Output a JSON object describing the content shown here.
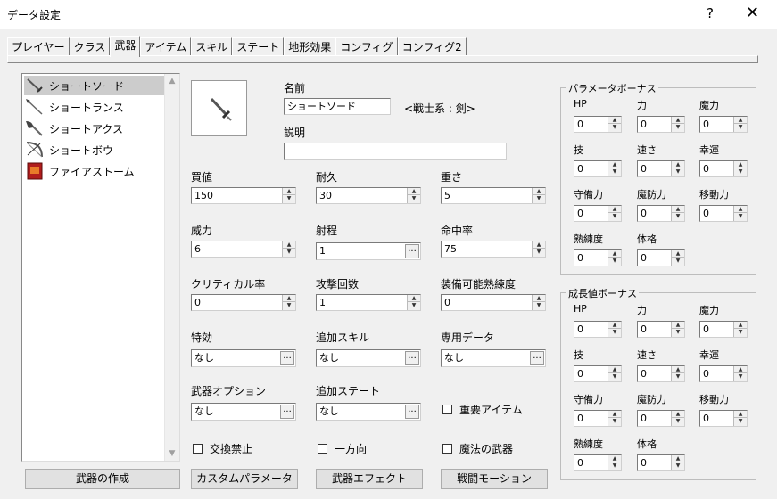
{
  "window": {
    "title": "データ設定",
    "help": "?",
    "close": "✕"
  },
  "tabs": [
    {
      "label": "プレイヤー"
    },
    {
      "label": "クラス"
    },
    {
      "label": "武器"
    },
    {
      "label": "アイテム"
    },
    {
      "label": "スキル"
    },
    {
      "label": "ステート"
    },
    {
      "label": "地形効果"
    },
    {
      "label": "コンフィグ"
    },
    {
      "label": "コンフィグ2"
    }
  ],
  "weapons": [
    {
      "label": "ショートソード",
      "icon": "sword-icon"
    },
    {
      "label": "ショートランス",
      "icon": "lance-icon"
    },
    {
      "label": "ショートアクス",
      "icon": "axe-icon"
    },
    {
      "label": "ショートボウ",
      "icon": "bow-icon"
    },
    {
      "label": "ファイアストーム",
      "icon": "tome-icon"
    }
  ],
  "selected_weapon": "ショートソード",
  "form": {
    "name_label": "名前",
    "name_value": "ショートソード",
    "type_text": "<戦士系 : 剣>",
    "desc_label": "説明",
    "desc_value": "",
    "price_label": "買値",
    "price": "150",
    "durability_label": "耐久",
    "durability": "30",
    "weight_label": "重さ",
    "weight": "5",
    "power_label": "威力",
    "power": "6",
    "range_label": "射程",
    "range": "1",
    "hit_label": "命中率",
    "hit": "75",
    "crit_label": "クリティカル率",
    "crit": "0",
    "attack_count_label": "攻撃回数",
    "attack_count": "1",
    "wlv_label": "装備可能熟練度",
    "wlv": "0",
    "effective_label": "特効",
    "effective": "なし",
    "add_skill_label": "追加スキル",
    "add_skill": "なし",
    "exclusive_label": "専用データ",
    "exclusive": "なし",
    "option_label": "武器オプション",
    "option": "なし",
    "add_state_label": "追加ステート",
    "add_state": "なし",
    "important_label": "重要アイテム",
    "no_trade_label": "交換禁止",
    "one_way_label": "一方向",
    "magic_label": "魔法の武器",
    "dots": "..."
  },
  "param_bonus": {
    "title": "パラメータボーナス",
    "stats": [
      {
        "label": "HP",
        "value": "0"
      },
      {
        "label": "力",
        "value": "0"
      },
      {
        "label": "魔力",
        "value": "0"
      },
      {
        "label": "技",
        "value": "0"
      },
      {
        "label": "速さ",
        "value": "0"
      },
      {
        "label": "幸運",
        "value": "0"
      },
      {
        "label": "守備力",
        "value": "0"
      },
      {
        "label": "魔防力",
        "value": "0"
      },
      {
        "label": "移動力",
        "value": "0"
      },
      {
        "label": "熟練度",
        "value": "0"
      },
      {
        "label": "体格",
        "value": "0"
      }
    ]
  },
  "growth_bonus": {
    "title": "成長値ボーナス",
    "stats": [
      {
        "label": "HP",
        "value": "0"
      },
      {
        "label": "力",
        "value": "0"
      },
      {
        "label": "魔力",
        "value": "0"
      },
      {
        "label": "技",
        "value": "0"
      },
      {
        "label": "速さ",
        "value": "0"
      },
      {
        "label": "幸運",
        "value": "0"
      },
      {
        "label": "守備力",
        "value": "0"
      },
      {
        "label": "魔防力",
        "value": "0"
      },
      {
        "label": "移動力",
        "value": "0"
      },
      {
        "label": "熟練度",
        "value": "0"
      },
      {
        "label": "体格",
        "value": "0"
      }
    ]
  },
  "buttons": {
    "create": "武器の作成",
    "custom_param": "カスタムパラメータ",
    "weapon_effect": "武器エフェクト",
    "battle_motion": "戦闘モーション"
  }
}
